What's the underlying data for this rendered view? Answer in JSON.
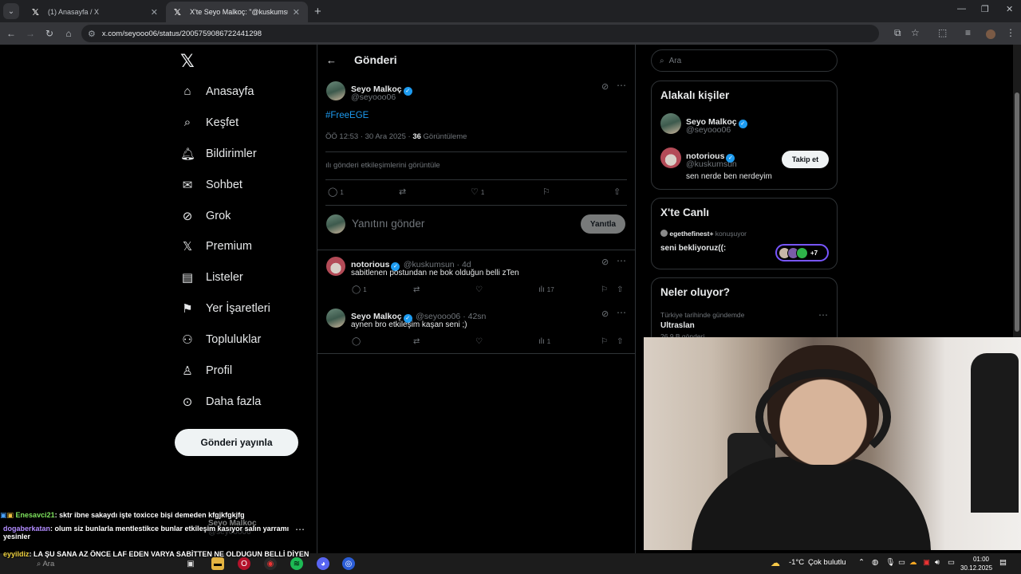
{
  "browser": {
    "tabs": [
      {
        "title": "(1) Anasayfa / X",
        "active": false
      },
      {
        "title": "X'te Seyo Malkoç: \"@kuskumsu",
        "active": true
      }
    ],
    "url": "x.com/seyooo06/status/2005759086722441298"
  },
  "nav": {
    "items": [
      {
        "label": "Anasayfa",
        "icon": "home-icon"
      },
      {
        "label": "Keşfet",
        "icon": "search-icon"
      },
      {
        "label": "Bildirimler",
        "icon": "bell-icon"
      },
      {
        "label": "Sohbet",
        "icon": "mail-icon"
      },
      {
        "label": "Grok",
        "icon": "grok-icon"
      },
      {
        "label": "Premium",
        "icon": "x-icon"
      },
      {
        "label": "Listeler",
        "icon": "list-icon"
      },
      {
        "label": "Yer İşaretleri",
        "icon": "bookmark-icon"
      },
      {
        "label": "Topluluklar",
        "icon": "people-icon"
      },
      {
        "label": "Profil",
        "icon": "person-icon"
      },
      {
        "label": "Daha fazla",
        "icon": "more-circle-icon"
      }
    ],
    "post_button": "Gönderi yayınla"
  },
  "header": {
    "title": "Gönderi"
  },
  "post": {
    "name": "Seyo Malkoç",
    "handle": "@seyooo06",
    "text": "#FreeEGE",
    "time": "ÖÖ 12:53 · 30 Ara 2025 ·",
    "views": "36",
    "views_label": "Görüntüleme",
    "analytics": "gönderi etkileşimlerini görüntüle",
    "reply_count": "1",
    "like_count": "1"
  },
  "composer": {
    "placeholder": "Yanıtını gönder",
    "button": "Yanıtla"
  },
  "replies": [
    {
      "name": "notorious",
      "handle": "@kuskumsun · 4d",
      "text": "sabitlenen postundan ne bok olduğun belli zTen",
      "reply_count": "1",
      "views": "17"
    },
    {
      "name": "Seyo Malkoç",
      "handle": "@seyooo06 · 42sn",
      "text": "aynen bro etkileşim kaşan seni ;)",
      "views": "1"
    }
  ],
  "sidebar": {
    "search_placeholder": "Ara",
    "related_title": "Alakalı kişiler",
    "related": [
      {
        "name": "Seyo Malkoç",
        "handle": "@seyooo06"
      },
      {
        "name": "notorious",
        "handle": "@kuskumsun",
        "bio": "sen nerde ben nerdeyim",
        "follow": "Takip et"
      }
    ],
    "live_title": "X'te Canlı",
    "live_host": "egethefinest+",
    "live_status": "konuşuyor",
    "live_text": "seni bekliyoruz((:",
    "live_count": "+7",
    "trends_title": "Neler oluyor?",
    "trend_context": "Türkiye tarihinde gündemde",
    "trend_name": "Ultraslan",
    "trend_posts": "26,9 B gönderi"
  },
  "chat": [
    {
      "user": "Enesavci21",
      "msg": ": sktr ibne sakaydı işte toxicce bişi demeden kfgjkfgkjfg"
    },
    {
      "user": "dogaberkatan",
      "msg": ": olum siz bunlarla mentlestikce bunlar etkileşim kasıyor salın yarramı yesinler"
    },
    {
      "user": "eyyildiz",
      "msg": ": LA ŞU SANA AZ ÖNCE LAF EDEN VARYA SABİTTEN NE OLDUGUN BELLİ DİYEN"
    }
  ],
  "pending_account": {
    "name": "Seyo Malkoç",
    "handle": "@seyooo06"
  },
  "taskbar": {
    "search": "Ara",
    "weather": "-1°C",
    "weather_desc": "Çok bulutlu",
    "time": "01:00",
    "date": "30.12.2025"
  },
  "colors": {
    "accent": "#1d9bf0",
    "background": "#000000",
    "border": "#2f3336",
    "live": "#7856ff"
  }
}
